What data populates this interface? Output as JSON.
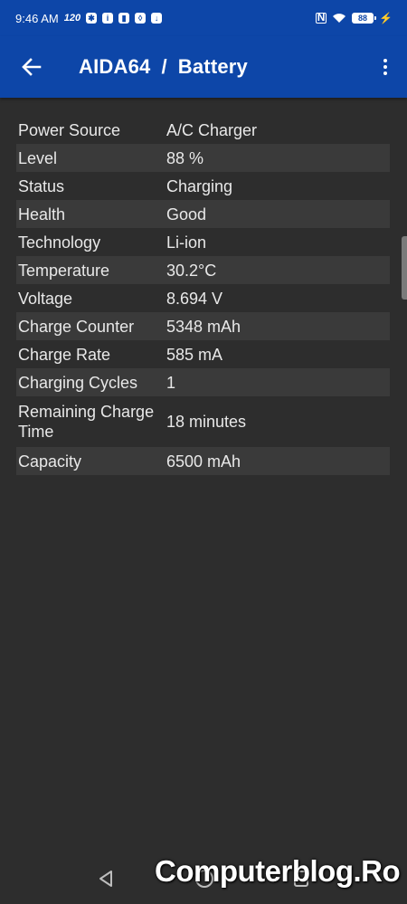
{
  "status_bar": {
    "time": "9:46 AM",
    "refresh_rate": "120",
    "battery_level": "88",
    "icons": [
      "settings-icon",
      "info-icon",
      "lock-icon",
      "shield-icon",
      "download-icon",
      "nfc-icon",
      "wifi-icon",
      "battery-icon",
      "charging-bolt-icon"
    ]
  },
  "app_bar": {
    "app_name": "AIDA64",
    "separator": "/",
    "page_title": "Battery",
    "color": "#0d46a8"
  },
  "battery_info": {
    "rows": [
      {
        "label": "Power Source",
        "value": "A/C Charger"
      },
      {
        "label": "Level",
        "value": "88 %"
      },
      {
        "label": "Status",
        "value": "Charging"
      },
      {
        "label": "Health",
        "value": "Good"
      },
      {
        "label": "Technology",
        "value": "Li-ion"
      },
      {
        "label": "Temperature",
        "value": "30.2°C"
      },
      {
        "label": "Voltage",
        "value": "8.694 V"
      },
      {
        "label": "Charge Counter",
        "value": "5348 mAh"
      },
      {
        "label": "Charge Rate",
        "value": "585 mA"
      },
      {
        "label": "Charging Cycles",
        "value": "1"
      },
      {
        "label": "Remaining Charge Time",
        "value": "18 minutes"
      },
      {
        "label": "Capacity",
        "value": "6500 mAh"
      }
    ]
  },
  "watermark": "Computerblog.Ro"
}
